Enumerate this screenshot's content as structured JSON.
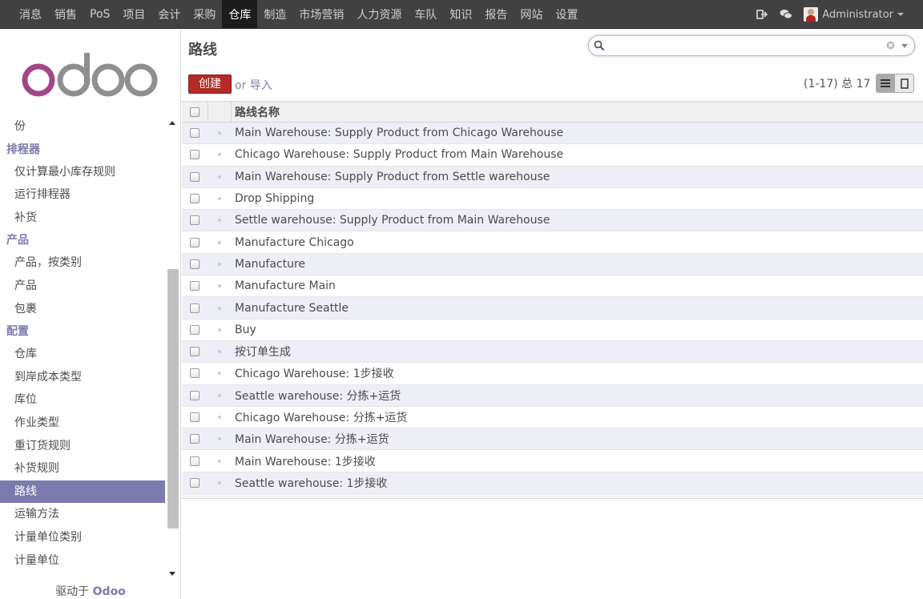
{
  "topmenu": {
    "items": [
      "消息",
      "销售",
      "PoS",
      "项目",
      "会计",
      "采购",
      "仓库",
      "制造",
      "市场营销",
      "人力资源",
      "车队",
      "知识",
      "报告",
      "网站",
      "设置"
    ],
    "active_index": 6
  },
  "user": {
    "name": "Administrator"
  },
  "sidebar": {
    "logo_text": "odoo",
    "partial_item": "份",
    "sections": [
      {
        "title": "排程器",
        "items": [
          "仅计算最小库存规则",
          "运行排程器",
          "补货"
        ]
      },
      {
        "title": "产品",
        "items": [
          "产品，按类别",
          "产品",
          "包裹"
        ]
      },
      {
        "title": "配置",
        "items": [
          "仓库",
          "到岸成本类型",
          "库位",
          "作业类型",
          "重订货规则",
          "补货规则",
          "路线",
          "运输方法",
          "计量单位类别",
          "计量单位"
        ]
      }
    ],
    "selected_item": "路线",
    "footer_prefix": "驱动于",
    "footer_brand": "Odoo"
  },
  "main": {
    "title": "路线",
    "search": {
      "placeholder": "",
      "value": ""
    },
    "create_label": "创建",
    "or_label": "or",
    "import_label": "导入",
    "pager": "(1-17) 总 17",
    "column_header": "路线名称",
    "rows": [
      "Main Warehouse: Supply Product from Chicago Warehouse",
      "Chicago Warehouse: Supply Product from Main Warehouse",
      "Main Warehouse: Supply Product from Settle warehouse",
      "Drop Shipping",
      "Settle warehouse: Supply Product from Main Warehouse",
      "Manufacture Chicago",
      "Manufacture",
      "Manufacture Main",
      "Manufacture Seattle",
      "Buy",
      "按订单生成",
      "Chicago Warehouse: 1步接收",
      "Seattle warehouse: 分拣+运货",
      "Chicago Warehouse: 分拣+运货",
      "Main Warehouse: 分拣+运货",
      "Main Warehouse: 1步接收",
      "Seattle warehouse: 1步接收"
    ]
  },
  "colors": {
    "accent": "#7c7bad",
    "create": "#b42a28",
    "topbar": "#414141"
  },
  "icons": [
    "logout-icon",
    "chat-icon",
    "search-icon",
    "clear-icon",
    "list-view-icon",
    "form-view-icon"
  ]
}
